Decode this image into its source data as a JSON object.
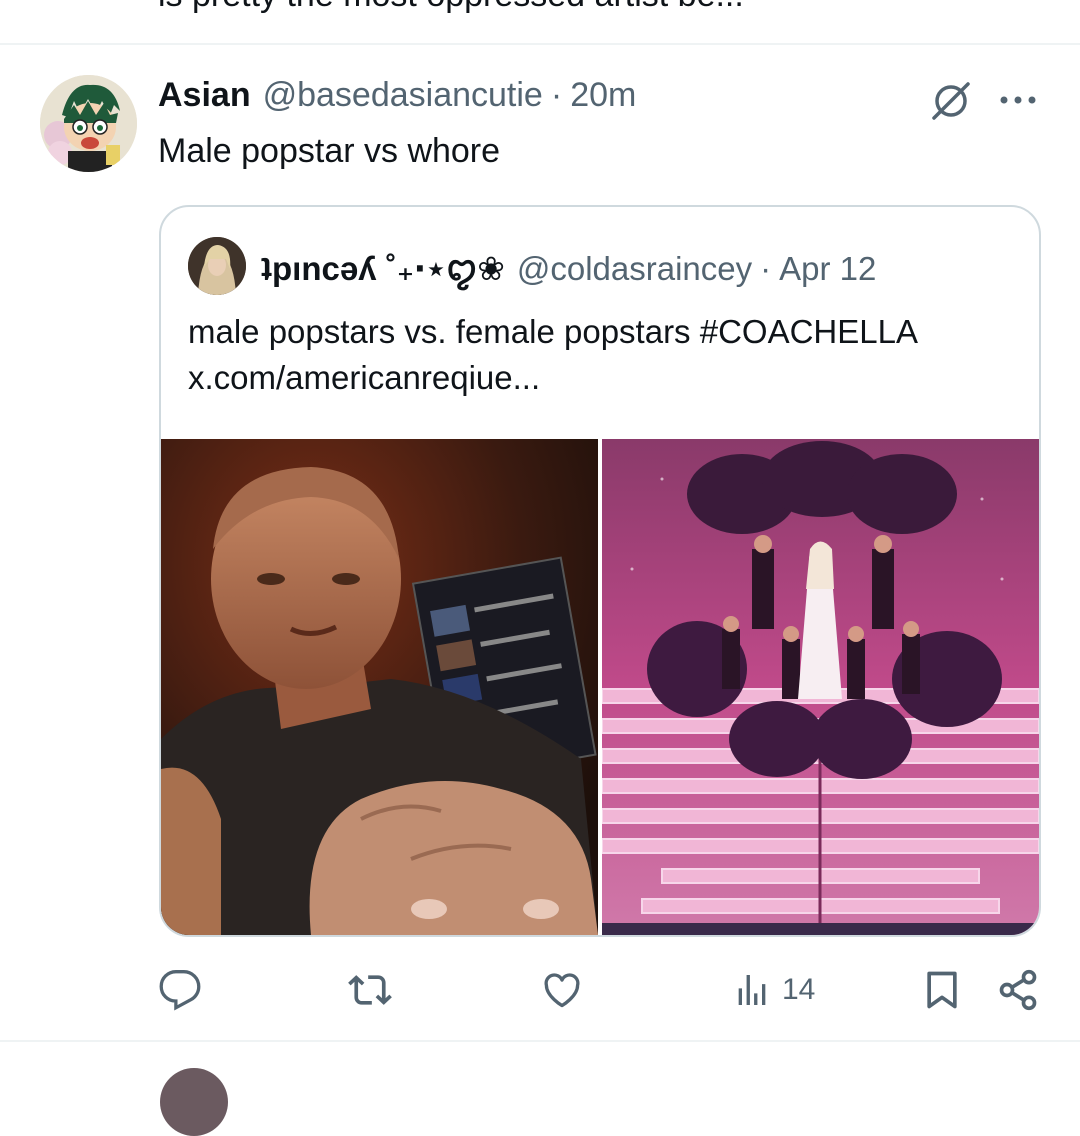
{
  "previous_post": {
    "text_fragment": "is pretty the most oppressed artist be..."
  },
  "post": {
    "author_name": "Asian",
    "author_handle": "@basedasiancutie",
    "separator": "·",
    "time": "20m",
    "text": "Male popstar vs whore",
    "icons": {
      "grok": "grok-icon",
      "more": "more-icon"
    }
  },
  "quote": {
    "author_name": "ʇpıncǝʎ ˚₊‧⋆ꨄ❀",
    "author_handle": "@coldasraincey",
    "separator": "·",
    "date": "Apr 12",
    "text_line1": "male popstars vs. female popstars #COACHELLA",
    "text_line2": "x.com/americanreqiue...",
    "media": [
      {
        "description": "male-popstar-selfie-photo"
      },
      {
        "description": "female-popstar-stage-performance-photo"
      }
    ]
  },
  "actions": {
    "reply": {
      "icon": "reply-icon",
      "count": ""
    },
    "repost": {
      "icon": "repost-icon",
      "count": ""
    },
    "like": {
      "icon": "like-icon",
      "count": ""
    },
    "views": {
      "icon": "views-icon",
      "count": "14"
    },
    "bookmark": {
      "icon": "bookmark-icon"
    },
    "share": {
      "icon": "share-icon"
    }
  },
  "colors": {
    "text_primary": "#0f1419",
    "text_secondary": "#536471",
    "border": "#cfd9de",
    "divider": "#eff3f4"
  }
}
